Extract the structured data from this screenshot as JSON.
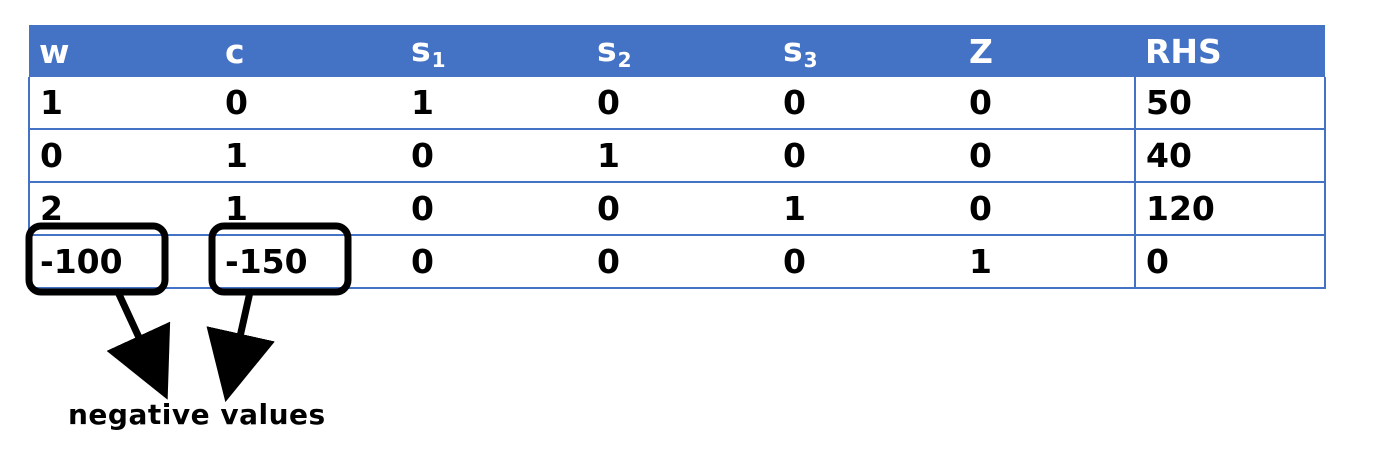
{
  "table": {
    "headers": [
      {
        "base": "w",
        "sub": ""
      },
      {
        "base": "c",
        "sub": ""
      },
      {
        "base": "s",
        "sub": "1"
      },
      {
        "base": "s",
        "sub": "2"
      },
      {
        "base": "s",
        "sub": "3"
      },
      {
        "base": "Z",
        "sub": ""
      },
      {
        "base": "RHS",
        "sub": ""
      }
    ],
    "rows": [
      [
        "1",
        "0",
        "1",
        "0",
        "0",
        "0",
        "50"
      ],
      [
        "0",
        "1",
        "0",
        "1",
        "0",
        "0",
        "40"
      ],
      [
        "2",
        "1",
        "0",
        "0",
        "1",
        "0",
        "120"
      ],
      [
        "-100",
        "-150",
        "0",
        "0",
        "0",
        "1",
        "0"
      ]
    ]
  },
  "annotation": {
    "label": "negative values",
    "highlighted_cells": [
      "-100",
      "-150"
    ]
  },
  "colors": {
    "header_bg": "#4472c4",
    "header_text": "#ffffff",
    "grid_line": "#4472c4",
    "callout": "#000000"
  }
}
